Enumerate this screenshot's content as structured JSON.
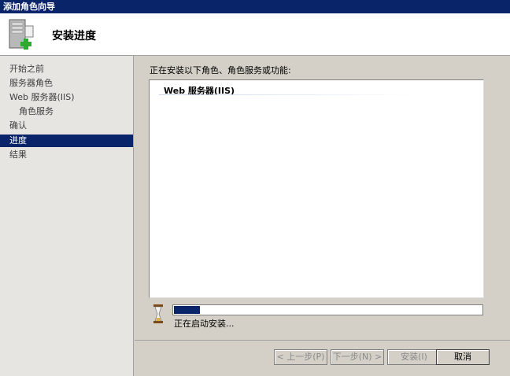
{
  "window": {
    "title": "添加角色向导"
  },
  "header": {
    "title": "安装进度",
    "icon": "server-add-icon"
  },
  "sidebar": {
    "items": [
      {
        "label": "开始之前"
      },
      {
        "label": "服务器角色"
      },
      {
        "label": "Web 服务器(IIS)"
      },
      {
        "label": "角色服务"
      },
      {
        "label": "确认"
      },
      {
        "label": "进度"
      },
      {
        "label": "结果"
      }
    ],
    "active": "进度"
  },
  "main": {
    "label": "正在安装以下角色、角色服务或功能:",
    "list_items": [
      {
        "label": "Web 服务器(IIS)"
      }
    ],
    "progress": {
      "value": 0.09,
      "status": "正在启动安装..."
    },
    "colors": {
      "accent": "#0a246a"
    }
  },
  "buttons": {
    "prev": "< 上一步(P)",
    "next": "下一步(N) >",
    "install": "安装(I)",
    "cancel": "取消"
  }
}
